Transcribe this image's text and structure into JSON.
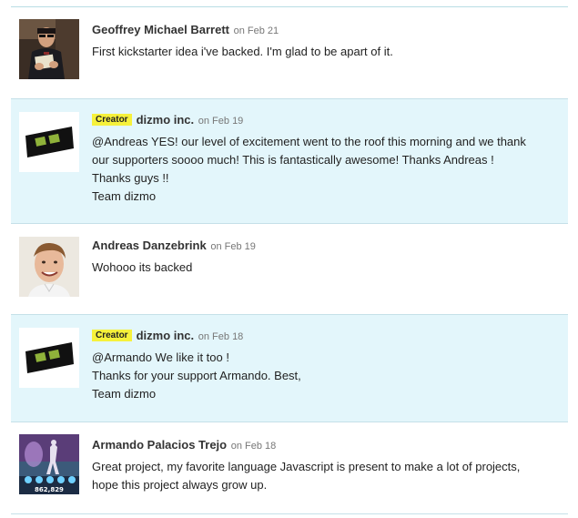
{
  "comments": [
    {
      "author": "Geoffrey Michael Barrett",
      "date": "on Feb 21",
      "is_creator": false,
      "avatar": "person-reading-photo",
      "lines": [
        "First kickstarter idea i've backed. I'm glad to be apart of it."
      ]
    },
    {
      "author": "dizmo inc.",
      "date": "on Feb 19",
      "is_creator": true,
      "badge": "Creator",
      "avatar": "dizmo-logo",
      "lines": [
        "@Andreas YES! our level of excitement went to the roof this morning and we thank",
        "our supporters soooo much! This is fantastically awesome! Thanks Andreas !",
        "Thanks guys !!",
        "Team dizmo"
      ]
    },
    {
      "author": "Andreas Danzebrink",
      "date": "on Feb 19",
      "is_creator": false,
      "avatar": "smiling-man-photo",
      "lines": [
        "Wohooo its backed"
      ]
    },
    {
      "author": "dizmo inc.",
      "date": "on Feb 18",
      "is_creator": true,
      "badge": "Creator",
      "avatar": "dizmo-logo",
      "lines": [
        "@Armando We like it too !",
        "Thanks for your support Armando. Best,",
        "Team dizmo"
      ]
    },
    {
      "author": "Armando Palacios Trejo",
      "date": "on Feb 18",
      "is_creator": false,
      "avatar": "game-screenshot",
      "avatar_caption": "862,829",
      "lines": [
        "Great project, my favorite language Javascript is present to make a lot of projects,",
        "hope this project always grow up."
      ]
    }
  ],
  "colors": {
    "creator_background": "#e3f6fb",
    "divider": "#c5e0e8",
    "creator_badge": "#f6f13b",
    "logo_green": "#8fb23a"
  }
}
